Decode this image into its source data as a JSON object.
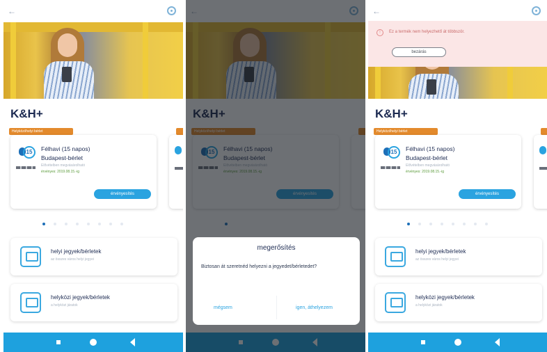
{
  "app": {
    "brand": "K&H+"
  },
  "ticket_card": {
    "badge": "Helyközi/helyi bérlet",
    "number": "15",
    "title_line1": "Félhavi (15 napos)",
    "title_line2": "Budapest-bérlet",
    "subtitle": "Elővételben megvásárolható",
    "valid": "érvényes: 2019.08.15.-ig",
    "activate_label": "érvényesítés"
  },
  "menu": {
    "item1": {
      "title": "helyi jegyek/bérletek",
      "subtitle": "az összes város helyi jegyei"
    },
    "item2": {
      "title": "helyközi jegyek/bérletek",
      "subtitle": "a helyközi járatok"
    }
  },
  "dialog": {
    "title": "megerősítés",
    "body": "Biztosan át szeretnéd helyezni a jegyedet/bérletedet?",
    "cancel_label": "mégsem",
    "confirm_label": "igen, áthelyezem"
  },
  "alert": {
    "message": "Ez a termék nem helyezhető át többször.",
    "retry_label": "bezárás"
  },
  "pager": {
    "count": 8,
    "active_index": 0
  },
  "colors": {
    "accent": "#1ea1de",
    "brand_navy": "#1d2b52",
    "badge_orange": "#e38a2c",
    "alert_bg": "#fbe6e6"
  }
}
